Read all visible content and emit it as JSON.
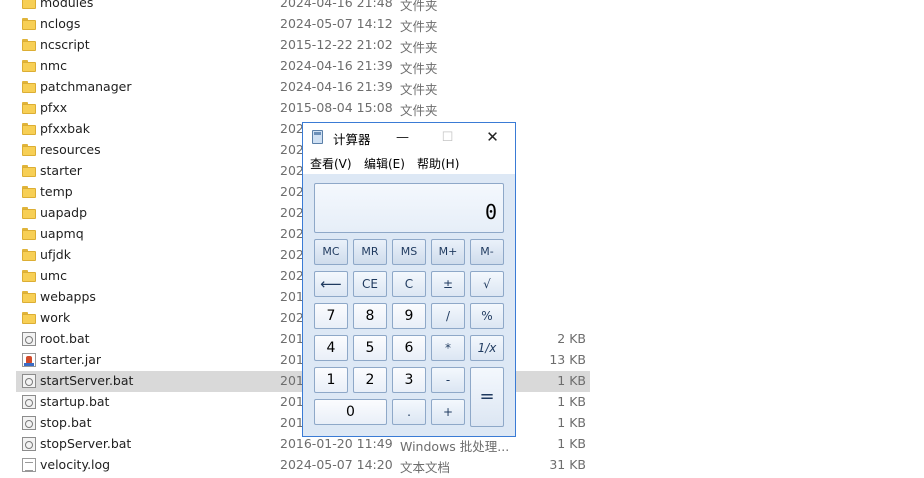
{
  "files": [
    {
      "name": "modules",
      "date": "2024-04-16 21:48",
      "type": "文件夹",
      "size": "",
      "icon": "folder-icon"
    },
    {
      "name": "nclogs",
      "date": "2024-05-07 14:12",
      "type": "文件夹",
      "size": "",
      "icon": "folder-icon"
    },
    {
      "name": "ncscript",
      "date": "2015-12-22 21:02",
      "type": "文件夹",
      "size": "",
      "icon": "folder-icon"
    },
    {
      "name": "nmc",
      "date": "2024-04-16 21:39",
      "type": "文件夹",
      "size": "",
      "icon": "folder-icon"
    },
    {
      "name": "patchmanager",
      "date": "2024-04-16 21:39",
      "type": "文件夹",
      "size": "",
      "icon": "folder-icon"
    },
    {
      "name": "pfxx",
      "date": "2015-08-04 15:08",
      "type": "文件夹",
      "size": "",
      "icon": "folder-icon"
    },
    {
      "name": "pfxxbak",
      "date": "202",
      "type": "",
      "size": "",
      "icon": "folder-icon"
    },
    {
      "name": "resources",
      "date": "202",
      "type": "",
      "size": "",
      "icon": "folder-icon"
    },
    {
      "name": "starter",
      "date": "202",
      "type": "",
      "size": "",
      "icon": "folder-icon"
    },
    {
      "name": "temp",
      "date": "202",
      "type": "",
      "size": "",
      "icon": "folder-icon"
    },
    {
      "name": "uapadp",
      "date": "202",
      "type": "",
      "size": "",
      "icon": "folder-icon"
    },
    {
      "name": "uapmq",
      "date": "202",
      "type": "",
      "size": "",
      "icon": "folder-icon"
    },
    {
      "name": "ufjdk",
      "date": "202",
      "type": "",
      "size": "",
      "icon": "folder-icon"
    },
    {
      "name": "umc",
      "date": "202",
      "type": "",
      "size": "",
      "icon": "folder-icon"
    },
    {
      "name": "webapps",
      "date": "201",
      "type": "",
      "size": "",
      "icon": "folder-icon"
    },
    {
      "name": "work",
      "date": "202",
      "type": "",
      "size": "",
      "icon": "folder-icon"
    },
    {
      "name": "root.bat",
      "date": "201",
      "type": "",
      "size": "2 KB",
      "icon": "bat-file-icon"
    },
    {
      "name": "starter.jar",
      "date": "201",
      "type": "",
      "size": "13 KB",
      "icon": "jar-file-icon"
    },
    {
      "name": "startServer.bat",
      "date": "201",
      "type": "",
      "size": "1 KB",
      "icon": "bat-file-icon",
      "selected": true
    },
    {
      "name": "startup.bat",
      "date": "201",
      "type": "",
      "size": "1 KB",
      "icon": "bat-file-icon"
    },
    {
      "name": "stop.bat",
      "date": "201",
      "type": "",
      "size": "1 KB",
      "icon": "bat-file-icon"
    },
    {
      "name": "stopServer.bat",
      "date": "2016-01-20 11:49",
      "type": "Windows 批处理...",
      "size": "1 KB",
      "icon": "bat-file-icon"
    },
    {
      "name": "velocity.log",
      "date": "2024-05-07 14:20",
      "type": "文本文档",
      "size": "31 KB",
      "icon": "log-file-icon"
    }
  ],
  "calculator": {
    "title": "计算器",
    "window_buttons": {
      "minimize": "—",
      "maximize": "☐",
      "close": "✕"
    },
    "menu": [
      "查看(V)",
      "编辑(E)",
      "帮助(H)"
    ],
    "display": "0",
    "keys": {
      "mc": "MC",
      "mr": "MR",
      "ms": "MS",
      "mplus": "M+",
      "mminus": "M-",
      "back": "⟵",
      "ce": "CE",
      "c": "C",
      "plusminus": "±",
      "sqrt": "√",
      "k7": "7",
      "k8": "8",
      "k9": "9",
      "div": "/",
      "pct": "%",
      "k4": "4",
      "k5": "5",
      "k6": "6",
      "mul": "*",
      "recip": "1/x",
      "k1": "1",
      "k2": "2",
      "k3": "3",
      "sub": "-",
      "eq": "=",
      "k0": "0",
      "dot": ".",
      "add": "+"
    }
  }
}
